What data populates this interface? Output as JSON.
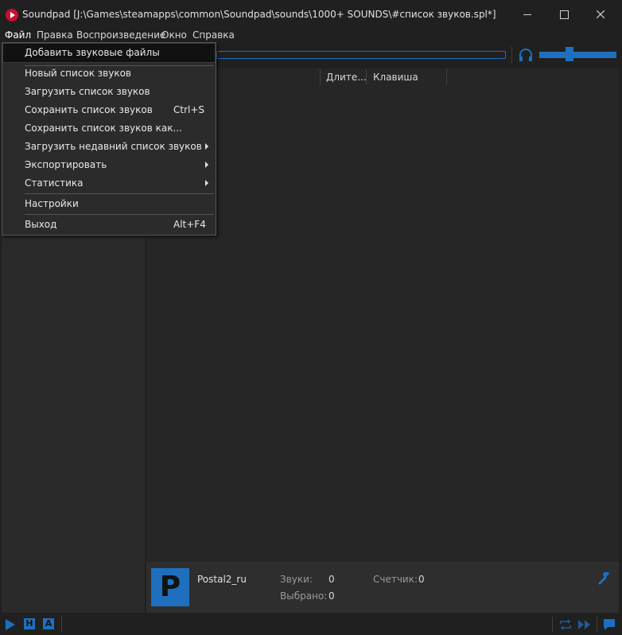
{
  "window": {
    "title": "Soundpad [J:\\Games\\steamapps\\common\\Soundpad\\sounds\\1000+ SOUNDS\\#список звуков.spl*]"
  },
  "menubar": {
    "items": [
      "Файл",
      "Правка",
      "Воспроизведение",
      "Окно",
      "Справка"
    ]
  },
  "file_menu": {
    "items": [
      {
        "label": "Добавить звуковые файлы",
        "shortcut": ""
      },
      {
        "label": "Новый список звуков",
        "shortcut": ""
      },
      {
        "label": "Загрузить список звуков",
        "shortcut": ""
      },
      {
        "label": "Сохранить список звуков",
        "shortcut": "Ctrl+S"
      },
      {
        "label": "Сохранить список звуков как...",
        "shortcut": ""
      },
      {
        "label": "Загрузить недавний список звуков",
        "shortcut": ""
      },
      {
        "label": "Экспортировать",
        "shortcut": ""
      },
      {
        "label": "Статистика",
        "shortcut": ""
      },
      {
        "label": "Настройки",
        "shortcut": ""
      },
      {
        "label": "Выход",
        "shortcut": "Alt+F4"
      }
    ]
  },
  "table": {
    "columns": [
      "Длите...",
      "Клавиша"
    ]
  },
  "info": {
    "logo_letter": "P",
    "list_name": "Postal2_ru",
    "sounds_label": "Звуки:",
    "sounds_value": "0",
    "selected_label": "Выбрано:",
    "selected_value": "0",
    "counter_label": "Счетчик:",
    "counter_value": "0"
  },
  "statusbar": {
    "h_label": "H",
    "a_label": "A"
  },
  "volume": {
    "level": 0.38
  },
  "colors": {
    "accent": "#1f6fbf",
    "background": "#202020",
    "close_icon": "#c8102e"
  }
}
